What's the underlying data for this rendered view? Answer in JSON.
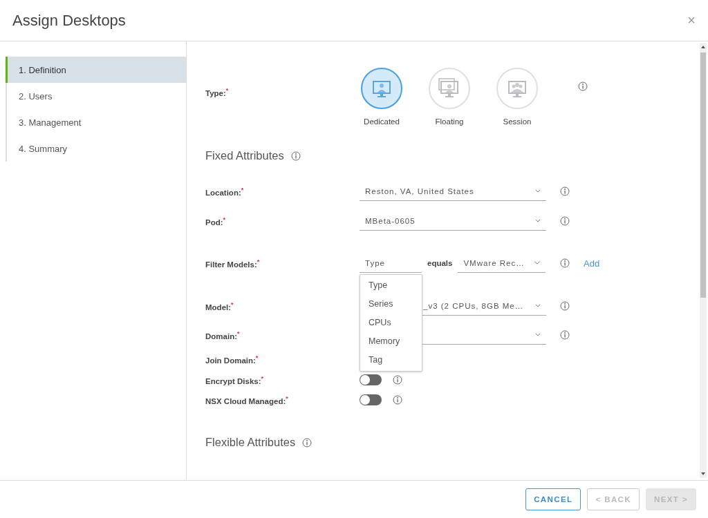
{
  "dialog": {
    "title": "Assign Desktops",
    "close": "×"
  },
  "steps": [
    {
      "label": "1. Definition",
      "selected": true
    },
    {
      "label": "2. Users",
      "selected": false
    },
    {
      "label": "3. Management",
      "selected": false
    },
    {
      "label": "4. Summary",
      "selected": false
    }
  ],
  "type_field": {
    "label": "Type:$^{*}$",
    "options": [
      {
        "label": "Dedicated",
        "selected": true,
        "kind": "single"
      },
      {
        "label": "Floating",
        "selected": false,
        "kind": "stacked"
      },
      {
        "label": "Session",
        "selected": false,
        "kind": "group"
      }
    ]
  },
  "fixed_attributes": {
    "title": "Fixed Attributes",
    "fields": [
      {
        "kind": "select",
        "label": "Location:$^{*}$",
        "value": "Reston, VA, United States",
        "info": true
      },
      {
        "kind": "select",
        "label": "Pod:$^{*}$",
        "value": "MBeta-0605",
        "info": true
      },
      {
        "kind": "filter",
        "label": "Filter Models:$^{*}$",
        "value": "Type",
        "operator": "equals",
        "match": "VMware Rec…",
        "info": true,
        "link": "Add",
        "menu": [
          "Type",
          "Series",
          "CPUs",
          "Memory",
          "Tag"
        ]
      },
      {
        "kind": "select",
        "label": "Model:$^{*}$",
        "value": "_v3 (2 CPUs, 8GB Me…",
        "offset": true,
        "info": true
      },
      {
        "kind": "select",
        "label": "Domain:$^{*}$",
        "info": true
      },
      {
        "kind": "plain",
        "label": "Join Domain:$^{*}$",
        "info": false
      },
      {
        "kind": "toggle",
        "label": "Encrypt Disks:$^{*}$",
        "on": false,
        "info": true
      },
      {
        "kind": "toggle",
        "label": "NSX Cloud Managed:$^{*}$",
        "on": false,
        "info": true
      }
    ]
  },
  "flexible_attributes": {
    "title": "Flexible Attributes"
  },
  "buttons": [
    {
      "label": "CANCEL",
      "kind": "outline",
      "disabled": false
    },
    {
      "label": "< BACK",
      "kind": "outline",
      "disabled": true
    },
    {
      "label": "NEXT >",
      "kind": "solid",
      "disabled": true
    }
  ]
}
